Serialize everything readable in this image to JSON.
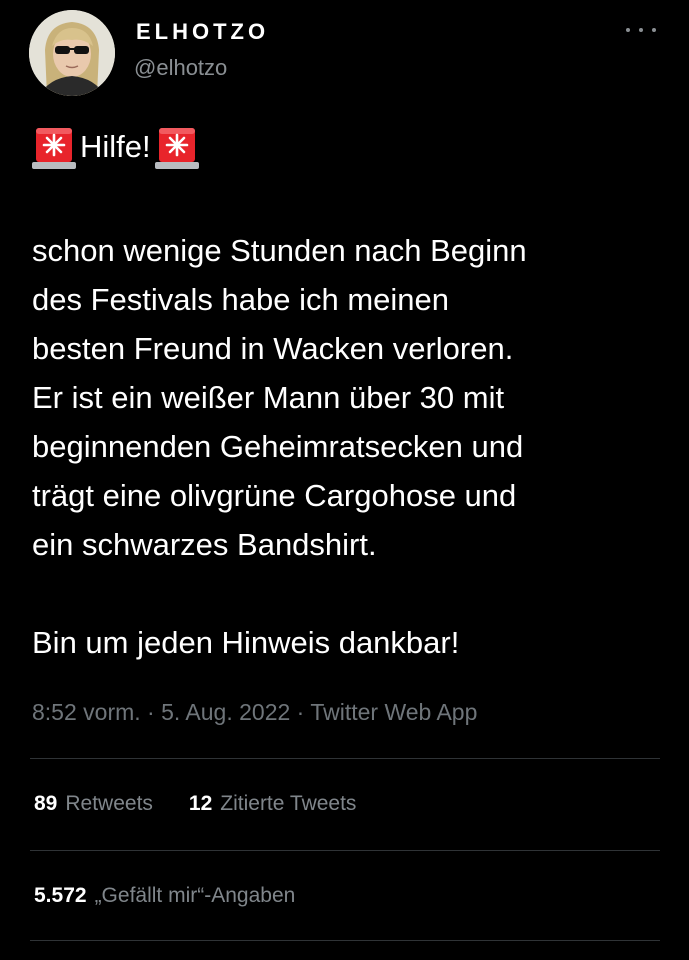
{
  "author": {
    "display_name": "ELHOTZO",
    "handle": "@elhotzo",
    "avatar_icon": "profile-photo"
  },
  "tweet": {
    "intro_text": "Hilfe!",
    "siren_icon": "rotating-light-emoji",
    "lines": [
      "schon wenige Stunden nach Beginn",
      "des Festivals habe ich meinen",
      "besten Freund in Wacken verloren.",
      "Er ist ein weißer Mann über 30 mit",
      "beginnenden Geheimratsecken und",
      "trägt eine olivgrüne Cargohose und",
      "ein schwarzes Bandshirt."
    ],
    "closing": "Bin um jeden Hinweis dankbar!"
  },
  "meta": {
    "time": "8:52 vorm.",
    "separator": " · ",
    "date": "5. Aug. 2022",
    "source": "Twitter Web App"
  },
  "stats": {
    "retweets_count": "89",
    "retweets_label": "Retweets",
    "quotes_count": "12",
    "quotes_label": "Zitierte Tweets",
    "likes_count": "5.572",
    "likes_label": "„Gefällt mir“-Angaben"
  },
  "colors": {
    "background": "#000000",
    "text": "#ffffff",
    "secondary": "#8a8f93",
    "divider": "#2f3336",
    "siren_red": "#e8242b"
  }
}
